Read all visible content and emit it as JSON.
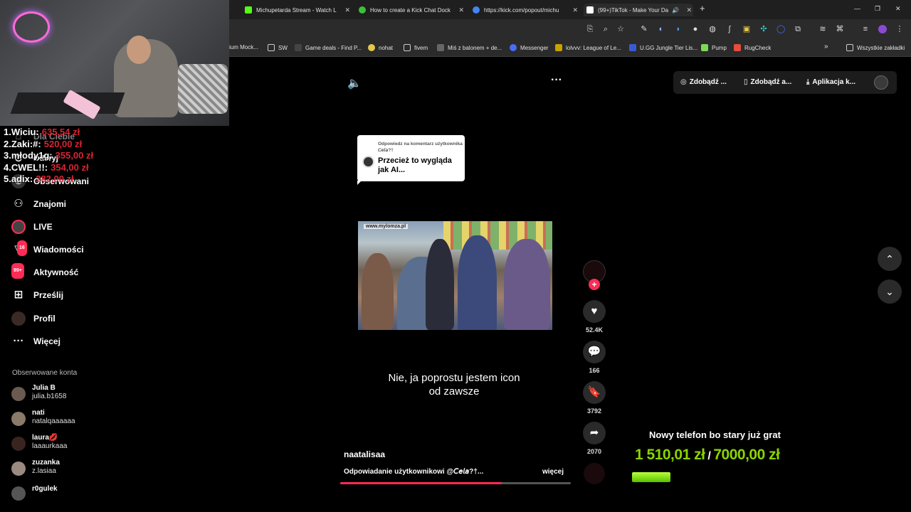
{
  "browser": {
    "tabs": [
      {
        "title": "Michupetarda Stream - Watch L",
        "color": "#53fc18"
      },
      {
        "title": "How to create a Kick Chat Dock",
        "color": "#3ac13a"
      },
      {
        "title": "https://kick.com/popout/michu",
        "color": "#4285f4"
      },
      {
        "title": "(99+)TikTok - Make Your Da",
        "color": "#ffffff",
        "active": true
      }
    ],
    "new_tab": "+",
    "window_controls": {
      "minimize": "—",
      "restore": "❐",
      "close": "✕"
    },
    "bookmarks": [
      {
        "label": "ium Mock...",
        "color": "#666"
      },
      {
        "label": "SW",
        "color": "#999"
      },
      {
        "label": "Game deals - Find P...",
        "color": "#444"
      },
      {
        "label": "nohat",
        "color": "#e3c84b"
      },
      {
        "label": "fivem",
        "color": "#999"
      },
      {
        "label": "Miś z balonem + de...",
        "color": "#666"
      },
      {
        "label": "Messenger",
        "color": "#4a6cf7"
      },
      {
        "label": "lolvvv: League of Le...",
        "color": "#c8a200"
      },
      {
        "label": "U.GG Jungle Tier Lis...",
        "color": "#3a5bd0"
      },
      {
        "label": "Pump",
        "color": "#7ed957"
      },
      {
        "label": "RugCheck",
        "color": "#e74c3c"
      }
    ],
    "bookmarks_more": "»",
    "all_bookmarks": "Wszystkie zakładki"
  },
  "stream_overlay": {
    "leaderboard": [
      {
        "rank_name": "1.Wiciu:",
        "amount": "635,54 zł"
      },
      {
        "rank_name": "2.Zaki:#:",
        "amount": "520,00 zł"
      },
      {
        "rank_name": "3.młody1g:",
        "amount": "355,00 zł"
      },
      {
        "rank_name": "4.CWEL!!:",
        "amount": "354,00 zł"
      },
      {
        "rank_name": "5.adix:",
        "amount": "282,00 zł"
      }
    ],
    "goal": {
      "title": "Nowy telefon bo stary już grat",
      "current": "1 510,01 zł",
      "separator": "/",
      "target": "7000,00 zł",
      "progress": 0.216
    }
  },
  "sidebar": {
    "items": [
      {
        "label": "Dla Ciebie",
        "icon": "home-icon"
      },
      {
        "label": "Odkryj",
        "icon": "compass-icon"
      },
      {
        "label": "Obserwowani",
        "icon": "following-icon"
      },
      {
        "label": "Znajomi",
        "icon": "friends-icon"
      },
      {
        "label": "LIVE",
        "icon": "live-icon"
      },
      {
        "label": "Wiadomości",
        "icon": "messages-icon",
        "badge": "16"
      },
      {
        "label": "Aktywność",
        "icon": "activity-icon",
        "badge": "99+"
      },
      {
        "label": "Prześlij",
        "icon": "upload-icon"
      },
      {
        "label": "Profil",
        "icon": "profile-icon"
      },
      {
        "label": "Więcej",
        "icon": "more-icon"
      }
    ],
    "followed_title": "Obserwowane konta",
    "accounts": [
      {
        "name": "Julia B",
        "handle": "julia.b1658"
      },
      {
        "name": "nati",
        "handle": "natalqaaaaaa"
      },
      {
        "name": "laura💋",
        "handle": "laaaurkaaa"
      },
      {
        "name": "zuzanka",
        "handle": "z.lasiaa"
      },
      {
        "name": "r0gulek",
        "handle": ""
      }
    ]
  },
  "topbar": {
    "coins": "Zdobądź ...",
    "app": "Zdobądź a...",
    "download": "Aplikacja k..."
  },
  "video": {
    "reply_card_title": "Odpowiedz na komentarz użytkownika 𝘊𝘦𝘭𝘢?†",
    "reply_card_text": "Przecież to wygląda jak AI...",
    "watermark": "www.mylomza.pl",
    "caption_line1": "Nie, ja poprostu jestem icon",
    "caption_line2": "od zawsze",
    "author": "naatalisaa",
    "description": "Odpowiadanie użytkownikowi @𝘊𝘦𝘭𝘢?†...",
    "more": "więcej",
    "progress": 0.7,
    "likes": "52.4K",
    "comments": "166",
    "saves": "3792",
    "shares": "2070"
  }
}
